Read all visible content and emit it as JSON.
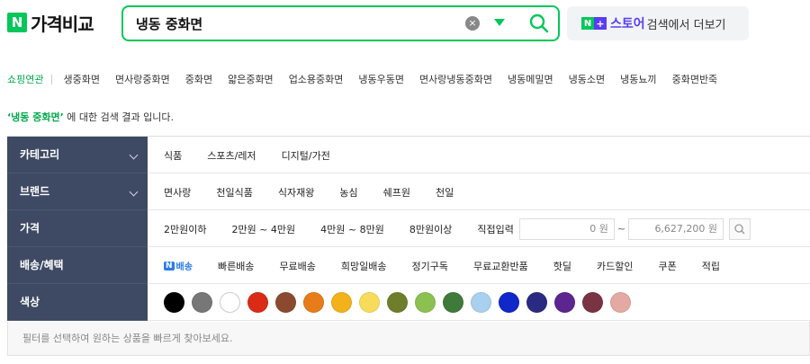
{
  "header": {
    "logo_letter": "N",
    "logo_text": "가격비교",
    "search_value": "냉동 중화면",
    "clear_label": "×",
    "store_badge_n": "N",
    "store_badge_plus": "+",
    "store_name": "스토어",
    "store_rest": "검색에서 더보기",
    "accent_color": "#03c75a",
    "store_color": "#5b3cf5"
  },
  "related": {
    "label": "쇼핑연관",
    "items": [
      "생중화면",
      "면사랑중화면",
      "중화면",
      "얇은중화면",
      "업소용중화면",
      "냉동우동면",
      "면사랑냉동중화면",
      "냉동메밀면",
      "냉동소면",
      "냉동뇨끼",
      "중화면반죽"
    ]
  },
  "result": {
    "query_quoted": "‘냉동 중화면’",
    "suffix": " 에 대한 검색 결과 입니다."
  },
  "filters": {
    "category": {
      "label": "카테고리",
      "options": [
        "식품",
        "스포츠/레저",
        "디지털/가전"
      ]
    },
    "brand": {
      "label": "브랜드",
      "options": [
        "면사랑",
        "천일식품",
        "식자재왕",
        "농심",
        "쉐프원",
        "천일"
      ]
    },
    "price": {
      "label": "가격",
      "options": [
        "2만원이하",
        "2만원 ~ 4만원",
        "4만원 ~ 8만원",
        "8만원이상"
      ],
      "direct_label": "직접입력",
      "min_value": "0 원",
      "max_value": "6,627,200 원",
      "tilde": "~"
    },
    "delivery": {
      "label": "배송/혜택",
      "badge_n": "N",
      "badge_text": "배송",
      "options": [
        "빠른배송",
        "무료배송",
        "희망일배송",
        "정기구독",
        "무료교환반품",
        "핫딜",
        "카드할인",
        "쿠폰",
        "적립"
      ]
    },
    "color": {
      "label": "색상",
      "swatches": [
        "#000000",
        "#777777",
        "#ffffff",
        "#d92b16",
        "#8b4a30",
        "#e87c1a",
        "#f2b21c",
        "#f7dc5c",
        "#6e7e2a",
        "#8cc152",
        "#3f7a3a",
        "#a9d0ee",
        "#1027c9",
        "#2a2a82",
        "#5c2590",
        "#7a3342",
        "#e4a9a2"
      ]
    }
  },
  "hint": "필터를 선택하여 원하는 상품을 빠르게 찾아보세요."
}
